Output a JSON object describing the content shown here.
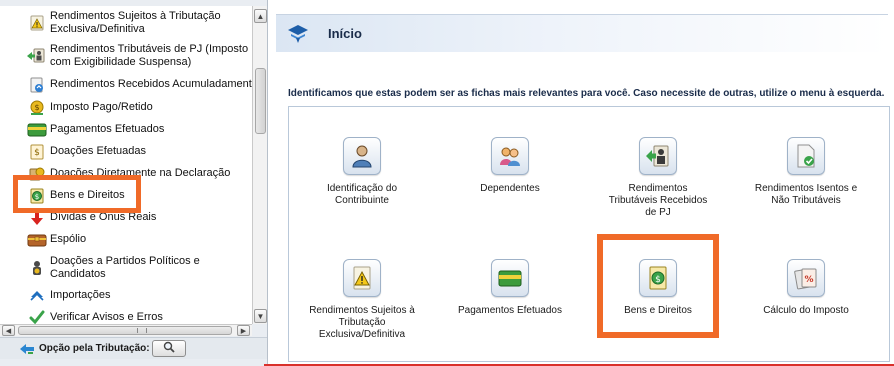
{
  "sidebar": {
    "items": [
      {
        "label": "Rendimentos Sujeitos à Tributação Exclusiva/Definitiva",
        "lines": [
          "Rendimentos Sujeitos à Tributação",
          "Exclusiva/Definitiva"
        ],
        "icon": "warning-doc-icon"
      },
      {
        "label": "Rendimentos Tributáveis de PJ (Imposto com Exigibilidade Suspensa)",
        "lines": [
          "Rendimentos Tributáveis de PJ (Imposto",
          "com Exigibilidade Suspensa)"
        ],
        "icon": "suspended-income-icon"
      },
      {
        "label": "Rendimentos Recebidos Acumuladamente",
        "lines": [
          "Rendimentos Recebidos Acumuladamente"
        ],
        "icon": "accumulated-income-icon"
      },
      {
        "label": "Imposto Pago/Retido",
        "lines": [
          "Imposto Pago/Retido"
        ],
        "icon": "tax-paid-icon"
      },
      {
        "label": "Pagamentos Efetuados",
        "lines": [
          "Pagamentos Efetuados"
        ],
        "icon": "payment-card-icon"
      },
      {
        "label": "Doações Efetuadas",
        "lines": [
          "Doações Efetuadas"
        ],
        "icon": "donation-icon"
      },
      {
        "label": "Doações Diretamente na Declaração",
        "lines": [
          "Doações Diretamente na Declaração"
        ],
        "icon": "direct-donation-icon"
      },
      {
        "label": "Bens e Direitos",
        "lines": [
          "Bens e Direitos"
        ],
        "icon": "assets-icon"
      },
      {
        "label": "Dívidas e Ônus Reais",
        "lines": [
          "Dívidas e Ônus Reais"
        ],
        "icon": "debt-arrow-icon"
      },
      {
        "label": "Espólio",
        "lines": [
          "Espólio"
        ],
        "icon": "estate-icon"
      },
      {
        "label": "Doações a Partidos Políticos e Candidatos",
        "lines": [
          "Doações a Partidos Políticos e",
          "Candidatos"
        ],
        "icon": "political-donation-icon"
      },
      {
        "label": "Importações",
        "lines": [
          "Importações"
        ],
        "icon": "import-icon"
      },
      {
        "label": "Verificar Avisos e Erros",
        "lines": [
          "Verificar Avisos e Erros"
        ],
        "icon": "checkmark-icon"
      }
    ],
    "option_label": "Opção pela Tributação:"
  },
  "main": {
    "title": "Início",
    "intro": "Identificamos que estas podem ser as fichas mais relevantes para você. Caso necessite de outras, utilize o menu à esquerda.",
    "cards": [
      {
        "label": "Identificação do Contribuinte",
        "lines": [
          "Identificação do",
          "Contribuinte"
        ],
        "icon": "contributor-icon"
      },
      {
        "label": "Dependentes",
        "lines": [
          "Dependentes"
        ],
        "icon": "dependents-icon"
      },
      {
        "label": "Rendimentos Tributáveis Recebidos de PJ",
        "lines": [
          "Rendimentos",
          "Tributáveis Recebidos",
          "de PJ"
        ],
        "icon": "pj-income-icon"
      },
      {
        "label": "Rendimentos Isentos e Não Tributáveis",
        "lines": [
          "Rendimentos Isentos e",
          "Não Tributáveis"
        ],
        "icon": "exempt-income-icon"
      },
      {
        "label": "Rendimentos Sujeitos à Tributação Exclusiva/Definitiva",
        "lines": [
          "Rendimentos Sujeitos à",
          "Tributação",
          "Exclusiva/Definitiva"
        ],
        "icon": "warning-doc-icon"
      },
      {
        "label": "Pagamentos Efetuados",
        "lines": [
          "Pagamentos Efetuados"
        ],
        "icon": "payment-card-icon"
      },
      {
        "label": "Bens e Direitos",
        "lines": [
          "Bens e Direitos"
        ],
        "icon": "assets-icon"
      },
      {
        "label": "Cálculo do Imposto",
        "lines": [
          "Cálculo do Imposto"
        ],
        "icon": "tax-calc-icon"
      }
    ]
  },
  "colors": {
    "highlight": "#f06a28",
    "accent_line": "#d9312b",
    "title_text": "#1a2c4a"
  }
}
